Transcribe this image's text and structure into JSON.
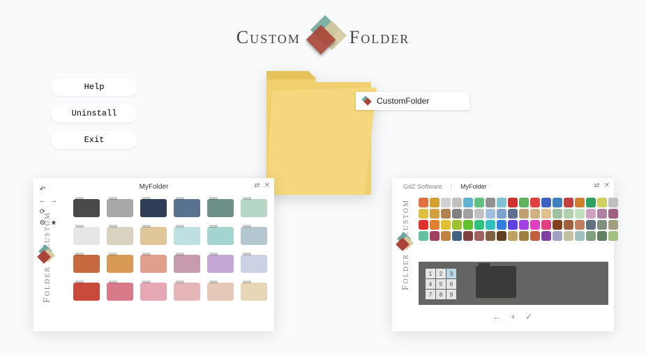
{
  "app": {
    "name_left": "Custom",
    "name_right": "Folder"
  },
  "buttons": {
    "help": "Help",
    "uninstall": "Uninstall",
    "exit": "Exit"
  },
  "context_menu": {
    "label": "CustomFolder"
  },
  "left_panel": {
    "title": "MyFolder",
    "vtext_top": "Custom",
    "vtext_bottom": "Folder",
    "folder_colors": [
      "#4a4a4a",
      "#a8a8a8",
      "#2f3e56",
      "#58728f",
      "#6d8f89",
      "#b5d6c4",
      "#e6e6e6",
      "#d9d2c0",
      "#e0c79a",
      "#bfe0e0",
      "#a4d4cf",
      "#b4c7d0",
      "#c46a3e",
      "#d99a57",
      "#e09f8a",
      "#c79aae",
      "#c6a8d6",
      "#cbd2e3",
      "#c94a3a",
      "#d97a8a",
      "#e6a8b4",
      "#e6b6b6",
      "#e6c8b6",
      "#e6d6b6"
    ],
    "toolbar": {
      "undo": "↶",
      "back": "←",
      "fwd": "→",
      "refresh": "⟳",
      "gear": "⚙",
      "star": "★"
    },
    "header_icons": {
      "shuffle": "⇄",
      "close": "✕"
    }
  },
  "right_panel": {
    "tab1": "GdZ Software",
    "tab2": "MyFolder",
    "vtext_top": "Custom",
    "vtext_bottom": "Folder",
    "header_icons": {
      "shuffle": "⇄",
      "close": "✕"
    },
    "emblem_colors": [
      "#e07040",
      "#d0a030",
      "#d0d0d0",
      "#c0c0c0",
      "#60b0d0",
      "#60c080",
      "#909090",
      "#80c0d0",
      "#d03030",
      "#60b060",
      "#e04040",
      "#4060c0",
      "#4080c0",
      "#c04040",
      "#d08030",
      "#30a060",
      "#d0d060",
      "#c0c0c0",
      "#e0c040",
      "#d0a040",
      "#b08050",
      "#808080",
      "#a0a0a0",
      "#c0c0c0",
      "#a0c0e0",
      "#80a0d0",
      "#607090",
      "#c0a070",
      "#d0b080",
      "#e0c090",
      "#a0c0a0",
      "#b0d0b0",
      "#c0e0c0",
      "#d0a0c0",
      "#b080a0",
      "#a06080",
      "#e03030",
      "#e08030",
      "#e0c030",
      "#a0c030",
      "#60c030",
      "#30c080",
      "#30c0c0",
      "#3080e0",
      "#6040e0",
      "#a040e0",
      "#e040c0",
      "#e04080",
      "#804020",
      "#a06040",
      "#c08060",
      "#607080",
      "#809080",
      "#a0a080",
      "#60c0a0",
      "#a04060",
      "#c08040",
      "#406080",
      "#804040",
      "#a06060",
      "#806040",
      "#604020",
      "#c0a060",
      "#a08040",
      "#c06040",
      "#8040a0",
      "#a0a0c0",
      "#c0c0a0",
      "#a0c0c0",
      "#80a080",
      "#608060",
      "#a0c080"
    ],
    "numpad": [
      "1",
      "2",
      "3",
      "4",
      "5",
      "6",
      "7",
      "8",
      "9"
    ],
    "numpad_selected": 2,
    "footer": {
      "back": "←",
      "add": "+",
      "confirm": "✓"
    }
  }
}
